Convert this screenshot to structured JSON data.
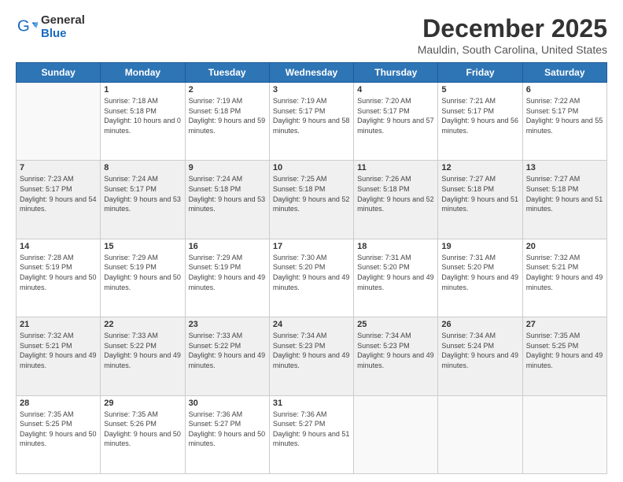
{
  "logo": {
    "general": "General",
    "blue": "Blue"
  },
  "title": "December 2025",
  "location": "Mauldin, South Carolina, United States",
  "days_of_week": [
    "Sunday",
    "Monday",
    "Tuesday",
    "Wednesday",
    "Thursday",
    "Friday",
    "Saturday"
  ],
  "weeks": [
    [
      {
        "day": "",
        "sunrise": "",
        "sunset": "",
        "daylight": ""
      },
      {
        "day": "1",
        "sunrise": "Sunrise: 7:18 AM",
        "sunset": "Sunset: 5:18 PM",
        "daylight": "Daylight: 10 hours and 0 minutes."
      },
      {
        "day": "2",
        "sunrise": "Sunrise: 7:19 AM",
        "sunset": "Sunset: 5:18 PM",
        "daylight": "Daylight: 9 hours and 59 minutes."
      },
      {
        "day": "3",
        "sunrise": "Sunrise: 7:19 AM",
        "sunset": "Sunset: 5:17 PM",
        "daylight": "Daylight: 9 hours and 58 minutes."
      },
      {
        "day": "4",
        "sunrise": "Sunrise: 7:20 AM",
        "sunset": "Sunset: 5:17 PM",
        "daylight": "Daylight: 9 hours and 57 minutes."
      },
      {
        "day": "5",
        "sunrise": "Sunrise: 7:21 AM",
        "sunset": "Sunset: 5:17 PM",
        "daylight": "Daylight: 9 hours and 56 minutes."
      },
      {
        "day": "6",
        "sunrise": "Sunrise: 7:22 AM",
        "sunset": "Sunset: 5:17 PM",
        "daylight": "Daylight: 9 hours and 55 minutes."
      }
    ],
    [
      {
        "day": "7",
        "sunrise": "Sunrise: 7:23 AM",
        "sunset": "Sunset: 5:17 PM",
        "daylight": "Daylight: 9 hours and 54 minutes."
      },
      {
        "day": "8",
        "sunrise": "Sunrise: 7:24 AM",
        "sunset": "Sunset: 5:17 PM",
        "daylight": "Daylight: 9 hours and 53 minutes."
      },
      {
        "day": "9",
        "sunrise": "Sunrise: 7:24 AM",
        "sunset": "Sunset: 5:18 PM",
        "daylight": "Daylight: 9 hours and 53 minutes."
      },
      {
        "day": "10",
        "sunrise": "Sunrise: 7:25 AM",
        "sunset": "Sunset: 5:18 PM",
        "daylight": "Daylight: 9 hours and 52 minutes."
      },
      {
        "day": "11",
        "sunrise": "Sunrise: 7:26 AM",
        "sunset": "Sunset: 5:18 PM",
        "daylight": "Daylight: 9 hours and 52 minutes."
      },
      {
        "day": "12",
        "sunrise": "Sunrise: 7:27 AM",
        "sunset": "Sunset: 5:18 PM",
        "daylight": "Daylight: 9 hours and 51 minutes."
      },
      {
        "day": "13",
        "sunrise": "Sunrise: 7:27 AM",
        "sunset": "Sunset: 5:18 PM",
        "daylight": "Daylight: 9 hours and 51 minutes."
      }
    ],
    [
      {
        "day": "14",
        "sunrise": "Sunrise: 7:28 AM",
        "sunset": "Sunset: 5:19 PM",
        "daylight": "Daylight: 9 hours and 50 minutes."
      },
      {
        "day": "15",
        "sunrise": "Sunrise: 7:29 AM",
        "sunset": "Sunset: 5:19 PM",
        "daylight": "Daylight: 9 hours and 50 minutes."
      },
      {
        "day": "16",
        "sunrise": "Sunrise: 7:29 AM",
        "sunset": "Sunset: 5:19 PM",
        "daylight": "Daylight: 9 hours and 49 minutes."
      },
      {
        "day": "17",
        "sunrise": "Sunrise: 7:30 AM",
        "sunset": "Sunset: 5:20 PM",
        "daylight": "Daylight: 9 hours and 49 minutes."
      },
      {
        "day": "18",
        "sunrise": "Sunrise: 7:31 AM",
        "sunset": "Sunset: 5:20 PM",
        "daylight": "Daylight: 9 hours and 49 minutes."
      },
      {
        "day": "19",
        "sunrise": "Sunrise: 7:31 AM",
        "sunset": "Sunset: 5:20 PM",
        "daylight": "Daylight: 9 hours and 49 minutes."
      },
      {
        "day": "20",
        "sunrise": "Sunrise: 7:32 AM",
        "sunset": "Sunset: 5:21 PM",
        "daylight": "Daylight: 9 hours and 49 minutes."
      }
    ],
    [
      {
        "day": "21",
        "sunrise": "Sunrise: 7:32 AM",
        "sunset": "Sunset: 5:21 PM",
        "daylight": "Daylight: 9 hours and 49 minutes."
      },
      {
        "day": "22",
        "sunrise": "Sunrise: 7:33 AM",
        "sunset": "Sunset: 5:22 PM",
        "daylight": "Daylight: 9 hours and 49 minutes."
      },
      {
        "day": "23",
        "sunrise": "Sunrise: 7:33 AM",
        "sunset": "Sunset: 5:22 PM",
        "daylight": "Daylight: 9 hours and 49 minutes."
      },
      {
        "day": "24",
        "sunrise": "Sunrise: 7:34 AM",
        "sunset": "Sunset: 5:23 PM",
        "daylight": "Daylight: 9 hours and 49 minutes."
      },
      {
        "day": "25",
        "sunrise": "Sunrise: 7:34 AM",
        "sunset": "Sunset: 5:23 PM",
        "daylight": "Daylight: 9 hours and 49 minutes."
      },
      {
        "day": "26",
        "sunrise": "Sunrise: 7:34 AM",
        "sunset": "Sunset: 5:24 PM",
        "daylight": "Daylight: 9 hours and 49 minutes."
      },
      {
        "day": "27",
        "sunrise": "Sunrise: 7:35 AM",
        "sunset": "Sunset: 5:25 PM",
        "daylight": "Daylight: 9 hours and 49 minutes."
      }
    ],
    [
      {
        "day": "28",
        "sunrise": "Sunrise: 7:35 AM",
        "sunset": "Sunset: 5:25 PM",
        "daylight": "Daylight: 9 hours and 50 minutes."
      },
      {
        "day": "29",
        "sunrise": "Sunrise: 7:35 AM",
        "sunset": "Sunset: 5:26 PM",
        "daylight": "Daylight: 9 hours and 50 minutes."
      },
      {
        "day": "30",
        "sunrise": "Sunrise: 7:36 AM",
        "sunset": "Sunset: 5:27 PM",
        "daylight": "Daylight: 9 hours and 50 minutes."
      },
      {
        "day": "31",
        "sunrise": "Sunrise: 7:36 AM",
        "sunset": "Sunset: 5:27 PM",
        "daylight": "Daylight: 9 hours and 51 minutes."
      },
      {
        "day": "",
        "sunrise": "",
        "sunset": "",
        "daylight": ""
      },
      {
        "day": "",
        "sunrise": "",
        "sunset": "",
        "daylight": ""
      },
      {
        "day": "",
        "sunrise": "",
        "sunset": "",
        "daylight": ""
      }
    ]
  ]
}
